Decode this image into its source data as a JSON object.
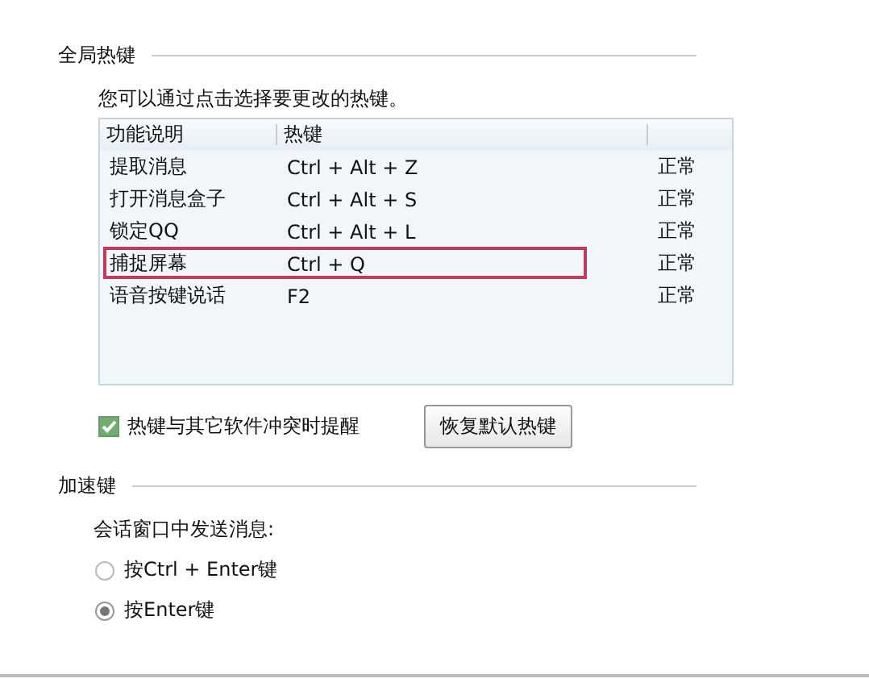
{
  "global_hotkeys": {
    "title": "全局热键",
    "hint": "您可以通过点击选择要更改的热键。",
    "table": {
      "columns": [
        "功能说明",
        "热键"
      ],
      "rows": [
        {
          "function": "提取消息",
          "hotkey": "Ctrl + Alt + Z",
          "status": "正常",
          "highlighted": false
        },
        {
          "function": "打开消息盒子",
          "hotkey": "Ctrl + Alt + S",
          "status": "正常",
          "highlighted": false
        },
        {
          "function": "锁定QQ",
          "hotkey": "Ctrl + Alt + L",
          "status": "正常",
          "highlighted": false
        },
        {
          "function": "捕捉屏幕",
          "hotkey": "Ctrl + Q",
          "status": "正常",
          "highlighted": true
        },
        {
          "function": "语音按键说话",
          "hotkey": "F2",
          "status": "正常",
          "highlighted": false
        }
      ]
    },
    "conflict_alert": {
      "label": "热键与其它软件冲突时提醒",
      "checked": true
    },
    "restore_button": "恢复默认热键"
  },
  "accelerator": {
    "title": "加速键",
    "prompt": "会话窗口中发送消息:",
    "options": [
      {
        "label": "按Ctrl + Enter键",
        "selected": false
      },
      {
        "label": "按Enter键",
        "selected": true
      }
    ]
  }
}
